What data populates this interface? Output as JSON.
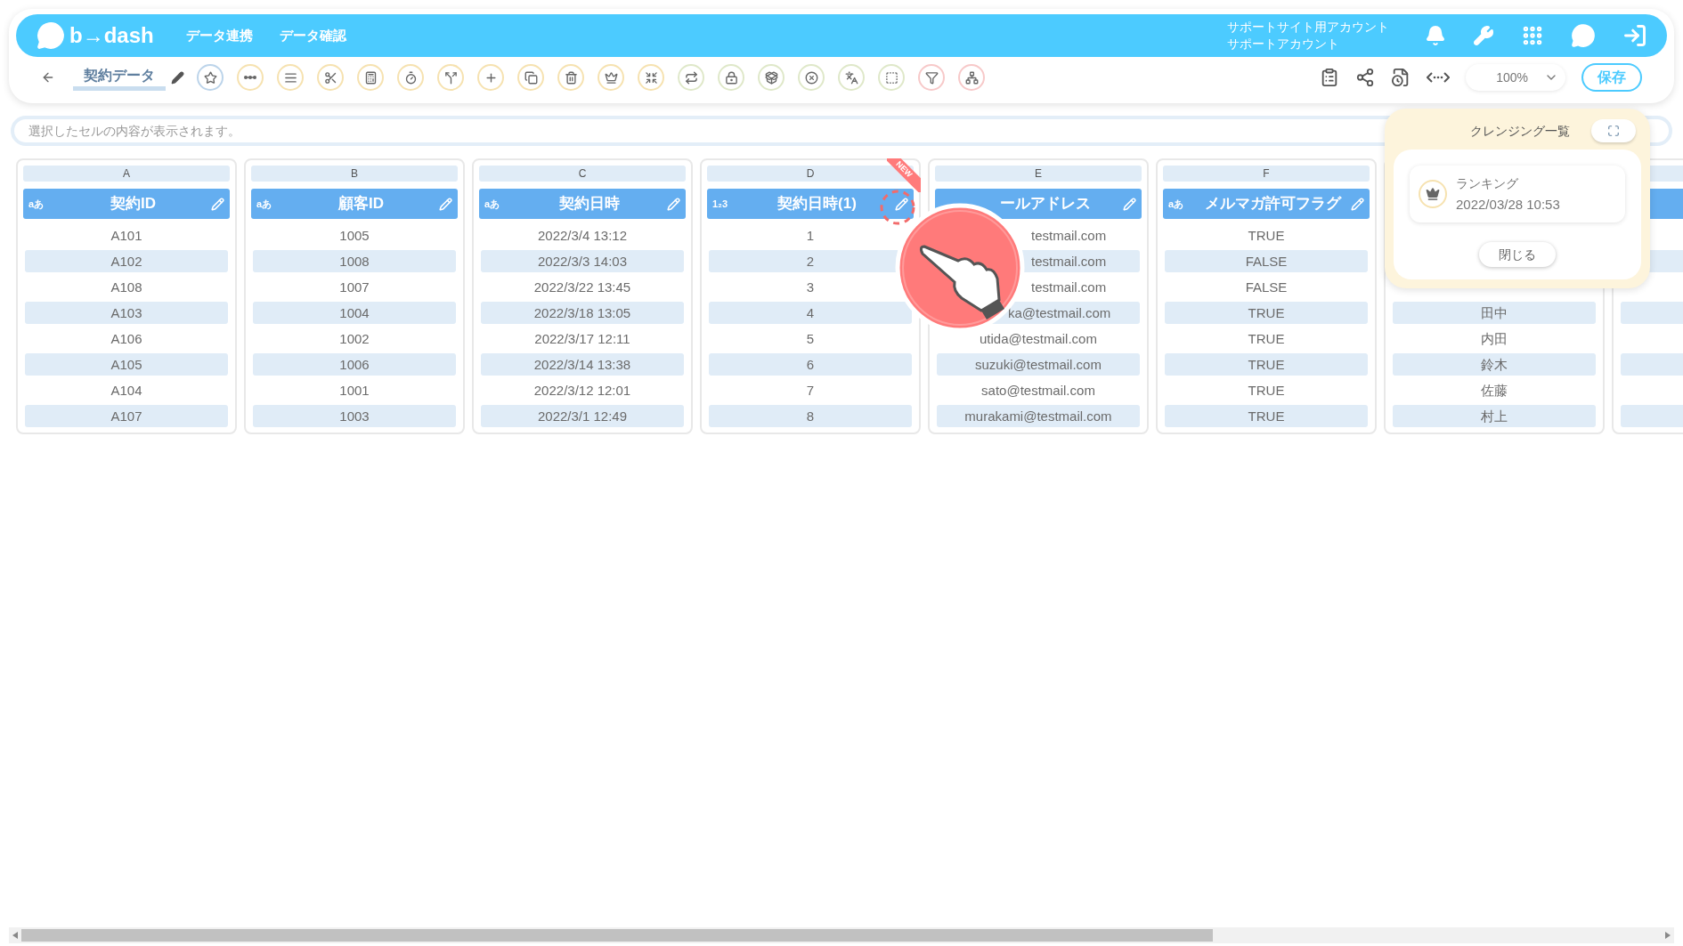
{
  "header": {
    "logo": "b→dash",
    "nav": [
      "データ連携",
      "データ確認"
    ],
    "account": [
      "サポートサイト用アカウント",
      "サポートアカウント"
    ]
  },
  "toolbar": {
    "title": "契約データ",
    "tools": [
      {
        "color": "#bcd4ea"
      },
      {
        "color": "#f6e2b0"
      },
      {
        "color": "#f6e2b0"
      },
      {
        "color": "#f6e2b0"
      },
      {
        "color": "#f6e2b0"
      },
      {
        "color": "#f6e2b0"
      },
      {
        "color": "#f6e2b0"
      },
      {
        "color": "#f6e2b0"
      },
      {
        "color": "#f6e2b0"
      },
      {
        "color": "#f6e2b0"
      },
      {
        "color": "#f6e2b0"
      },
      {
        "color": "#f6e2b0"
      },
      {
        "color": "#dfe8c9"
      },
      {
        "color": "#dfe8c9"
      },
      {
        "color": "#dfe8c9"
      },
      {
        "color": "#dfe8c9"
      },
      {
        "color": "#dfe8c9"
      },
      {
        "color": "#dfe8c9"
      },
      {
        "color": "#f7c9c9"
      },
      {
        "color": "#f7c9c9"
      }
    ],
    "zoom": "100%",
    "save": "保存"
  },
  "cell_viewer": {
    "placeholder": "選択したセルの内容が表示されます。"
  },
  "columns": [
    {
      "letter": "A",
      "name": "契約ID",
      "type_label": "aあ",
      "cells": [
        {
          "text": "A101"
        },
        {
          "text": "A102"
        },
        {
          "text": "A108"
        },
        {
          "text": "A103"
        },
        {
          "text": "A106"
        },
        {
          "text": "A105"
        },
        {
          "text": "A104"
        },
        {
          "text": "A107"
        }
      ]
    },
    {
      "letter": "B",
      "name": "顧客ID",
      "type_label": "aあ",
      "cells": [
        {
          "text": "1005"
        },
        {
          "text": "1008"
        },
        {
          "text": "1007"
        },
        {
          "text": "1004"
        },
        {
          "text": "1002"
        },
        {
          "text": "1006"
        },
        {
          "text": "1001"
        },
        {
          "text": "1003"
        }
      ]
    },
    {
      "letter": "C",
      "name": "契約日時",
      "type_label": "aあ",
      "cells": [
        {
          "text": "2022/3/4 13:12"
        },
        {
          "text": "2022/3/3 14:03"
        },
        {
          "text": "2022/3/22 13:45"
        },
        {
          "text": "2022/3/18 13:05"
        },
        {
          "text": "2022/3/17 12:11"
        },
        {
          "text": "2022/3/14 13:38"
        },
        {
          "text": "2022/3/12 12:01"
        },
        {
          "text": "2022/3/1 12:49"
        }
      ]
    },
    {
      "letter": "D",
      "name": "契約日時(1)",
      "type_label": "1₂3",
      "new": true,
      "new_label": "NEW",
      "cells": [
        {
          "text": "1"
        },
        {
          "text": "2"
        },
        {
          "text": "3"
        },
        {
          "text": "4"
        },
        {
          "text": "5"
        },
        {
          "text": "6"
        },
        {
          "text": "7"
        },
        {
          "text": "8"
        }
      ]
    },
    {
      "letter": "E",
      "name": "ールアドレス",
      "cells": [
        {
          "text": "testmail.com",
          "covered": true
        },
        {
          "text": "testmail.com",
          "covered": true
        },
        {
          "text": "testmail.com",
          "covered": true
        },
        {
          "text": "ka@testmail.com",
          "covered": true
        },
        {
          "text": "utida@testmail.com"
        },
        {
          "text": "suzuki@testmail.com"
        },
        {
          "text": "sato@testmail.com"
        },
        {
          "text": "murakami@testmail.com"
        }
      ]
    },
    {
      "letter": "F",
      "name": "メルマガ許可フラグ",
      "type_label": "aあ",
      "cells": [
        {
          "text": "TRUE"
        },
        {
          "text": "FALSE"
        },
        {
          "text": "FALSE"
        },
        {
          "text": "TRUE"
        },
        {
          "text": "TRUE"
        },
        {
          "text": "TRUE"
        },
        {
          "text": "TRUE"
        },
        {
          "text": "TRUE"
        }
      ]
    },
    {
      "cells": [
        {},
        {},
        {},
        {
          "text": "田中"
        },
        {
          "text": "内田"
        },
        {
          "text": "鈴木"
        },
        {
          "text": "佐藤"
        },
        {
          "text": "村上"
        }
      ]
    },
    {
      "cells": [
        {},
        {},
        {},
        {},
        {},
        {},
        {},
        {}
      ]
    }
  ],
  "cleansing_panel": {
    "title": "クレンジング一覧",
    "items": [
      {
        "name": "ランキング",
        "date": "2022/03/28 10:53"
      }
    ],
    "close": "閉じる"
  }
}
